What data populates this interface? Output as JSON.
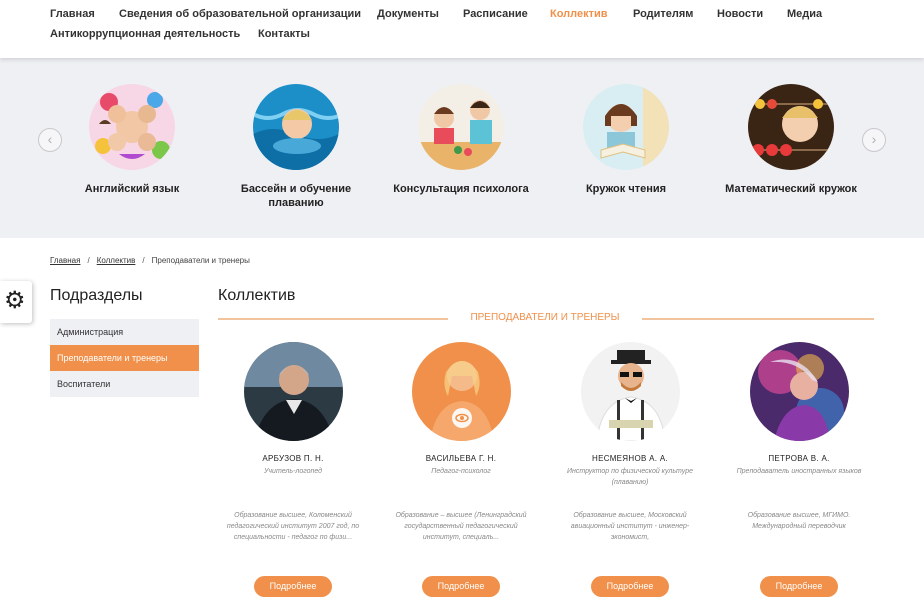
{
  "nav": {
    "items": [
      {
        "label": "Главная"
      },
      {
        "label": "Сведения об образовательной организации"
      },
      {
        "label": "Документы"
      },
      {
        "label": "Расписание"
      },
      {
        "label": "Коллектив",
        "active": true
      },
      {
        "label": "Родителям"
      },
      {
        "label": "Новости"
      },
      {
        "label": "Медиа"
      },
      {
        "label": "Антикоррупционная деятельность"
      },
      {
        "label": "Контакты"
      }
    ],
    "active_color": "#f0904a"
  },
  "slider": {
    "prev_icon": "chevron-left-icon",
    "next_icon": "chevron-right-icon",
    "slides": [
      {
        "title": "Английский язык"
      },
      {
        "title": "Бассейн и обучение плаванию"
      },
      {
        "title": "Консультация психолога"
      },
      {
        "title": "Кружок чтения"
      },
      {
        "title": "Математический кружок"
      }
    ]
  },
  "breadcrumb": {
    "home": "Главная",
    "section": "Коллектив",
    "current": "Преподаватели и тренеры",
    "separator": "/"
  },
  "settings": {
    "icon": "gear-icon",
    "glyph": "⚙"
  },
  "sidebar": {
    "title": "Подразделы",
    "items": [
      {
        "label": "Администрация"
      },
      {
        "label": "Преподаватели и тренеры",
        "active": true
      },
      {
        "label": "Воспитатели"
      }
    ]
  },
  "main": {
    "title": "Коллектив",
    "section_title": "ПРЕПОДАВАТЕЛИ И ТРЕНЕРЫ",
    "accent_color": "#f0904a",
    "staff": [
      {
        "name": "АРБУЗОВ П. Н.",
        "role": "Учитель-логопед",
        "education": "Образование высшее, Коломенский педагогический институт 2007 год, по специальности - педагог по физи...",
        "button": "Подробнее"
      },
      {
        "name": "ВАСИЛЬЕВА Г. Н.",
        "role": "Педагог-психолог",
        "education": "Образование – высшее (Ленинградский государственный педагогический институт,  специаль...",
        "button": "Подробнее"
      },
      {
        "name": "НЕСМЕЯНОВ А. А.",
        "role": "Инструктор по физической культуре (плаванию)",
        "education": "Образование высшее, Московский авиационный институт - инженер-экономист,",
        "button": "Подробнее"
      },
      {
        "name": "ПЕТРОВА В. А.",
        "role": "Преподаватель иностранных языков",
        "education": "Образование высшее, МГИМО. Международный переводчик",
        "button": "Подробнее"
      }
    ]
  }
}
